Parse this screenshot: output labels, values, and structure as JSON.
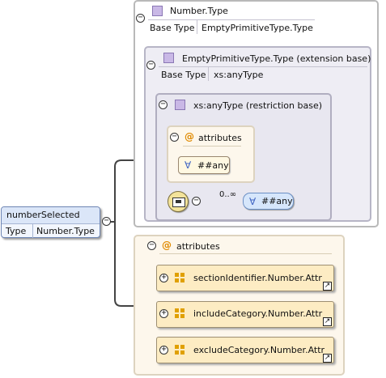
{
  "root_element": {
    "name": "numberSelected",
    "type_key": "Type",
    "type_value": "Number.Type"
  },
  "outer_type": {
    "title": "Number.Type",
    "base_key": "Base Type",
    "base_value": "EmptyPrimitiveType.Type"
  },
  "extension": {
    "title": "EmptyPrimitiveType.Type (extension base)",
    "base_key": "Base Type",
    "base_value": "xs:anyType"
  },
  "restriction": {
    "title": "xs:anyType (restriction base)",
    "attributes_label": "attributes",
    "any_attribute": "##any",
    "any_element": "##any",
    "occurrence": "0..∞"
  },
  "attributes_group": {
    "label": "attributes",
    "items": [
      {
        "label": "sectionIdentifier.Number.Attr"
      },
      {
        "label": "includeCategory.Number.Attr"
      },
      {
        "label": "excludeCategory.Number.Attr"
      }
    ]
  },
  "glyphs": {
    "collapse": "−",
    "expand": "+",
    "at": "@",
    "forall": "∀",
    "link": "↗"
  }
}
